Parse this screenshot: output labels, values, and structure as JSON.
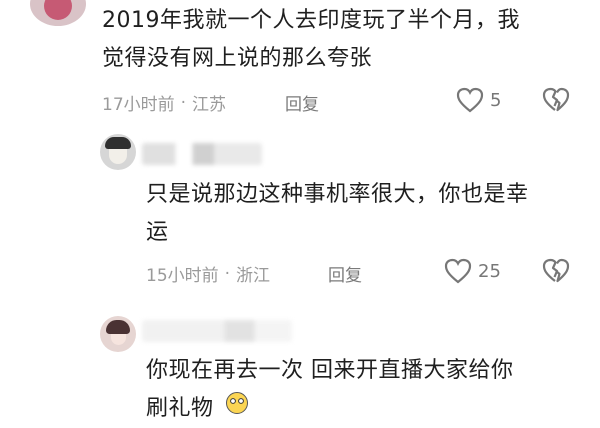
{
  "comments": [
    {
      "text_line1": "2019年我就一个人去印度玩了半个月，我",
      "text_line2": "觉得没有网上说的那么夸张",
      "time": "17小时前",
      "location": "江苏",
      "reply_label": "回复",
      "likes": "5",
      "icons": {
        "like": "heart-icon",
        "dislike": "broken-heart-icon"
      }
    },
    {
      "text_line1": "只是说那边这种事机率很大，你也是幸",
      "text_line2": "运",
      "time": "15小时前",
      "location": "浙江",
      "reply_label": "回复",
      "likes": "25",
      "icons": {
        "like": "heart-icon",
        "dislike": "broken-heart-icon"
      }
    },
    {
      "text_line1": "你现在再去一次 回来开直播大家给你",
      "text_line2": "刷礼物"
    }
  ],
  "separator": "·",
  "colors": {
    "text": "#1f1f1f",
    "meta": "#9a9a9a",
    "icon": "#777777",
    "background": "#ffffff"
  }
}
